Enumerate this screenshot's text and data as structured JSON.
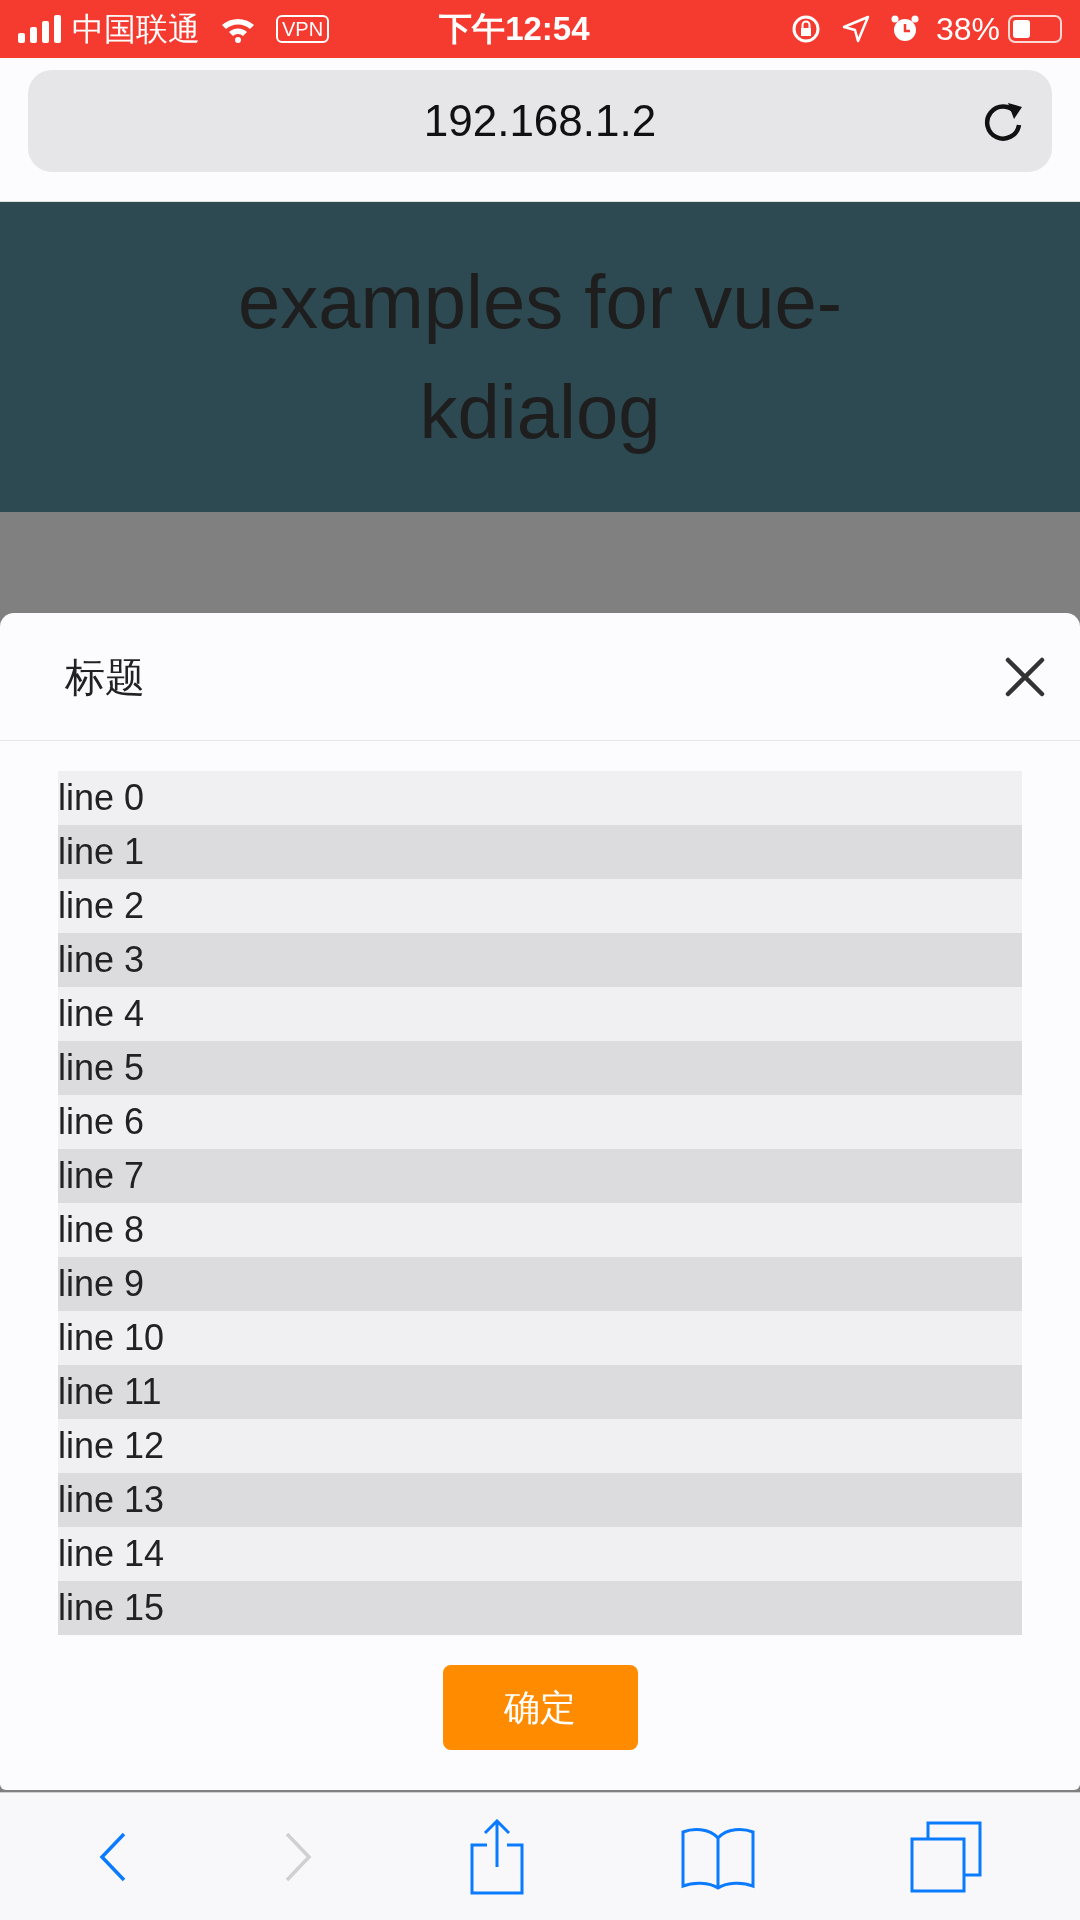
{
  "status_bar": {
    "carrier": "中国联通",
    "vpn": "VPN",
    "time": "下午12:54",
    "battery": "38%"
  },
  "address_bar": {
    "url": "192.168.1.2"
  },
  "page": {
    "title": "examples for vue-kdialog"
  },
  "dialog": {
    "title": "标题",
    "lines": [
      "line 0",
      "line 1",
      "line 2",
      "line 3",
      "line 4",
      "line 5",
      "line 6",
      "line 7",
      "line 8",
      "line 9",
      "line 10",
      "line 11",
      "line 12",
      "line 13",
      "line 14",
      "line 15"
    ],
    "confirm_button": "确定"
  },
  "toolbar": {
    "back_disabled": false,
    "forward_disabled": true
  }
}
